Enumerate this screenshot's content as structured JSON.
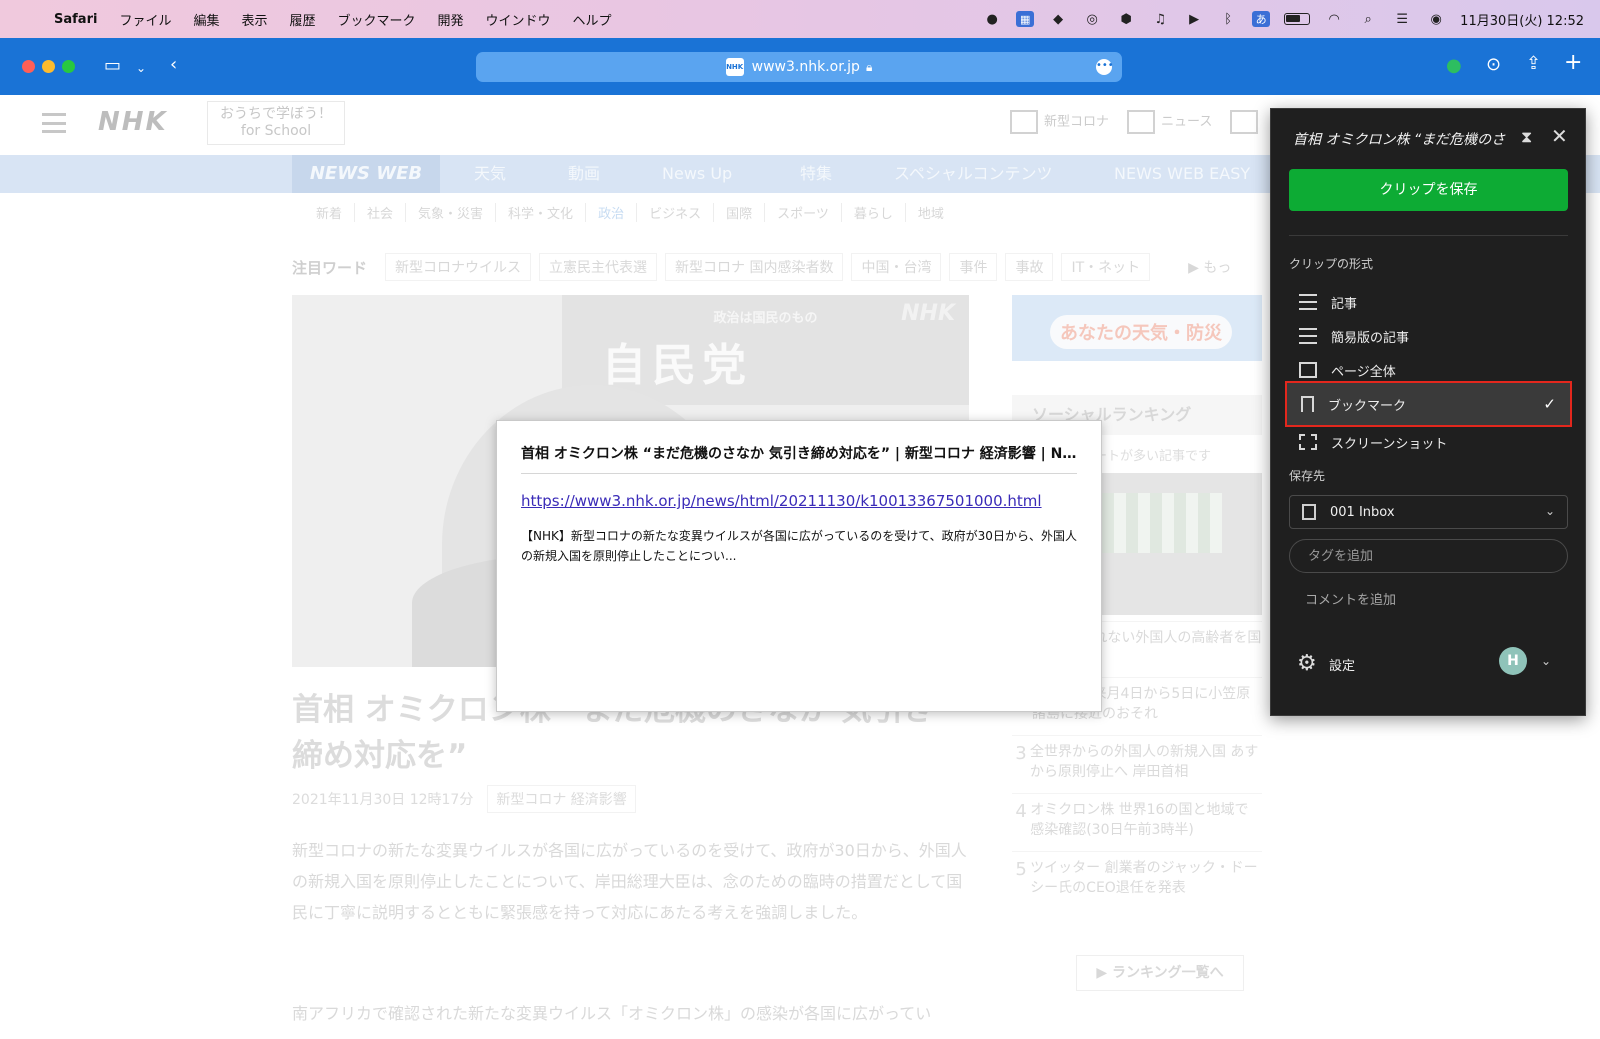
{
  "menubar": {
    "app_name": "Safari",
    "items": [
      "ファイル",
      "編集",
      "表示",
      "履歴",
      "ブックマーク",
      "開発",
      "ウインドウ",
      "ヘルプ"
    ],
    "ime_label": "あ",
    "clock": "11月30日(火) 12:52"
  },
  "browser": {
    "url": "www3.nhk.or.jp",
    "favicon_text": "NHK"
  },
  "nhk": {
    "logo": "NHK",
    "school_line1": "おうちで学ぼう！",
    "school_line2": "for School",
    "header_links": [
      "新型コロナ",
      "ニュース"
    ],
    "nav_brand": "NEWS WEB",
    "nav": [
      "天気",
      "動画",
      "News Up",
      "特集",
      "スペシャルコンテンツ",
      "NEWS WEB EASY"
    ],
    "subnav": [
      "新着",
      "社会",
      "気象・災害",
      "科学・文化",
      "政治",
      "ビジネス",
      "国際",
      "スポーツ",
      "暮らし",
      "地域"
    ],
    "subnav_active": "政治",
    "keywords_title": "注目ワード",
    "keywords": [
      "新型コロナウイルス",
      "立憲民主代表選",
      "新型コロナ 国内感染者数",
      "中国・台湾",
      "事件",
      "事故",
      "IT・ネット"
    ],
    "keywords_more": "▶ もっ",
    "hero_banner_top": "政治は国民のもの",
    "hero_banner_main": "自民党",
    "hero_banner_nhk": "NHK",
    "article_title": "首相 オミクロン株 “まだ危機のさなか 気引き締め対応を”",
    "article_date": "2021年11月30日 12時17分",
    "article_tag": "新型コロナ 経済影響",
    "article_body": "新型コロナの新たな変異ウイルスが各国に広がっているのを受けて、政府が30日から、外国人の新規入国を原則停止したことについて、岸田総理大臣は、念のための臨時の措置だとして国民に丁寧に説明するとともに緊張感を持って対応にあたる考えを強調しました。",
    "article_body2": "南アフリカで確認された新たな変異ウイルス「オミクロン株」の感染が各国に広がってい",
    "weather_label": "あなたの天気・防災",
    "ranking_title": "ソーシャルランキング",
    "ranking_sub": "ツイートが多い記事です",
    "ranking": [
      {
        "num": "",
        "text": "…国に入れない外国人の高齢者を国に要請"
      },
      {
        "num": "2",
        "text": "…月発生 来月4日から5日に小笠原諸島に接近のおそれ"
      },
      {
        "num": "3",
        "text": "全世界からの外国人の新規入国 あすから原則停止へ 岸田首相"
      },
      {
        "num": "4",
        "text": "オミクロン株 世界16の国と地域で感染確認(30日午前3時半)"
      },
      {
        "num": "5",
        "text": "ツイッター 創業者のジャック・ドーシー氏のCEO退任を発表"
      }
    ],
    "ranking_more": "▶ ランキング一覧へ"
  },
  "preview": {
    "title": "首相 オミクロン株 “まだ危機のさなか 気引き締め対応を” | 新型コロナ 経済影響 | N...",
    "url": "https://www3.nhk.or.jp/news/html/20211130/k10013367501000.html",
    "description": "【NHK】新型コロナの新たな変異ウイルスが各国に広がっているのを受けて、政府が30日から、外国人の新規入国を原則停止したことについ..."
  },
  "clipper": {
    "title": "首相 オミクロン株 “まだ危機のさ",
    "save_button": "クリップを保存",
    "format_label": "クリップの形式",
    "formats": [
      {
        "label": "記事",
        "icon": "article-icon"
      },
      {
        "label": "簡易版の記事",
        "icon": "simplified-article-icon"
      },
      {
        "label": "ページ全体",
        "icon": "full-page-icon"
      },
      {
        "label": "ブックマーク",
        "icon": "bookmark-icon"
      },
      {
        "label": "スクリーンショット",
        "icon": "screenshot-icon"
      }
    ],
    "selected_format": "ブックマーク",
    "destination_label": "保存先",
    "notebook": "001 Inbox",
    "tag_placeholder": "タグを追加",
    "comment_placeholder": "コメントを追加",
    "settings_label": "設定",
    "avatar_initial": "H",
    "highlight_color": "#e3271d",
    "save_color": "#0dab34"
  }
}
